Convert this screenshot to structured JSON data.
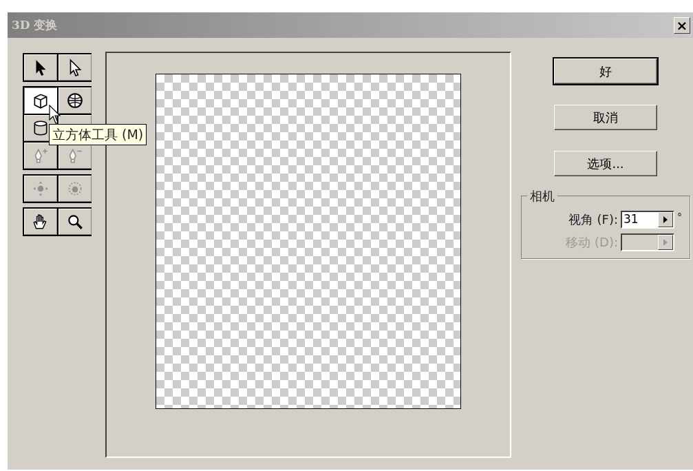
{
  "window": {
    "title": "3D 变换",
    "close": "×"
  },
  "tool_groups": [
    {
      "tools": [
        {
          "kind": "select",
          "selected": false,
          "disabled": false
        },
        {
          "kind": "direct-select",
          "selected": false,
          "disabled": false
        }
      ]
    },
    {
      "tools": [
        {
          "kind": "cube",
          "selected": true,
          "disabled": false
        },
        {
          "kind": "sphere",
          "selected": false,
          "disabled": false
        },
        {
          "kind": "cylinder",
          "selected": false,
          "disabled": false
        },
        {
          "kind": "covered",
          "selected": false
        },
        {
          "kind": "anchor-add",
          "selected": false,
          "disabled": true
        },
        {
          "kind": "anchor-remove",
          "selected": false,
          "disabled": true
        }
      ]
    },
    {
      "tools": [
        {
          "kind": "pan-camera",
          "selected": false,
          "disabled": true
        },
        {
          "kind": "trackball",
          "selected": false,
          "disabled": true
        }
      ]
    },
    {
      "tools": [
        {
          "kind": "hand",
          "selected": false,
          "disabled": false
        },
        {
          "kind": "zoom",
          "selected": false,
          "disabled": false
        }
      ]
    }
  ],
  "tooltip": "立方体工具 (M)",
  "buttons": [
    {
      "label": "好",
      "default": true
    },
    {
      "label": "取消",
      "default": false
    },
    {
      "label": "选项...",
      "default": false
    }
  ],
  "camera": {
    "title": "相机",
    "fields": [
      {
        "label": "视角 (F):",
        "value": "31",
        "unit": "°",
        "disabled": false
      },
      {
        "label": "移动 (D):",
        "disabled": true
      }
    ]
  }
}
